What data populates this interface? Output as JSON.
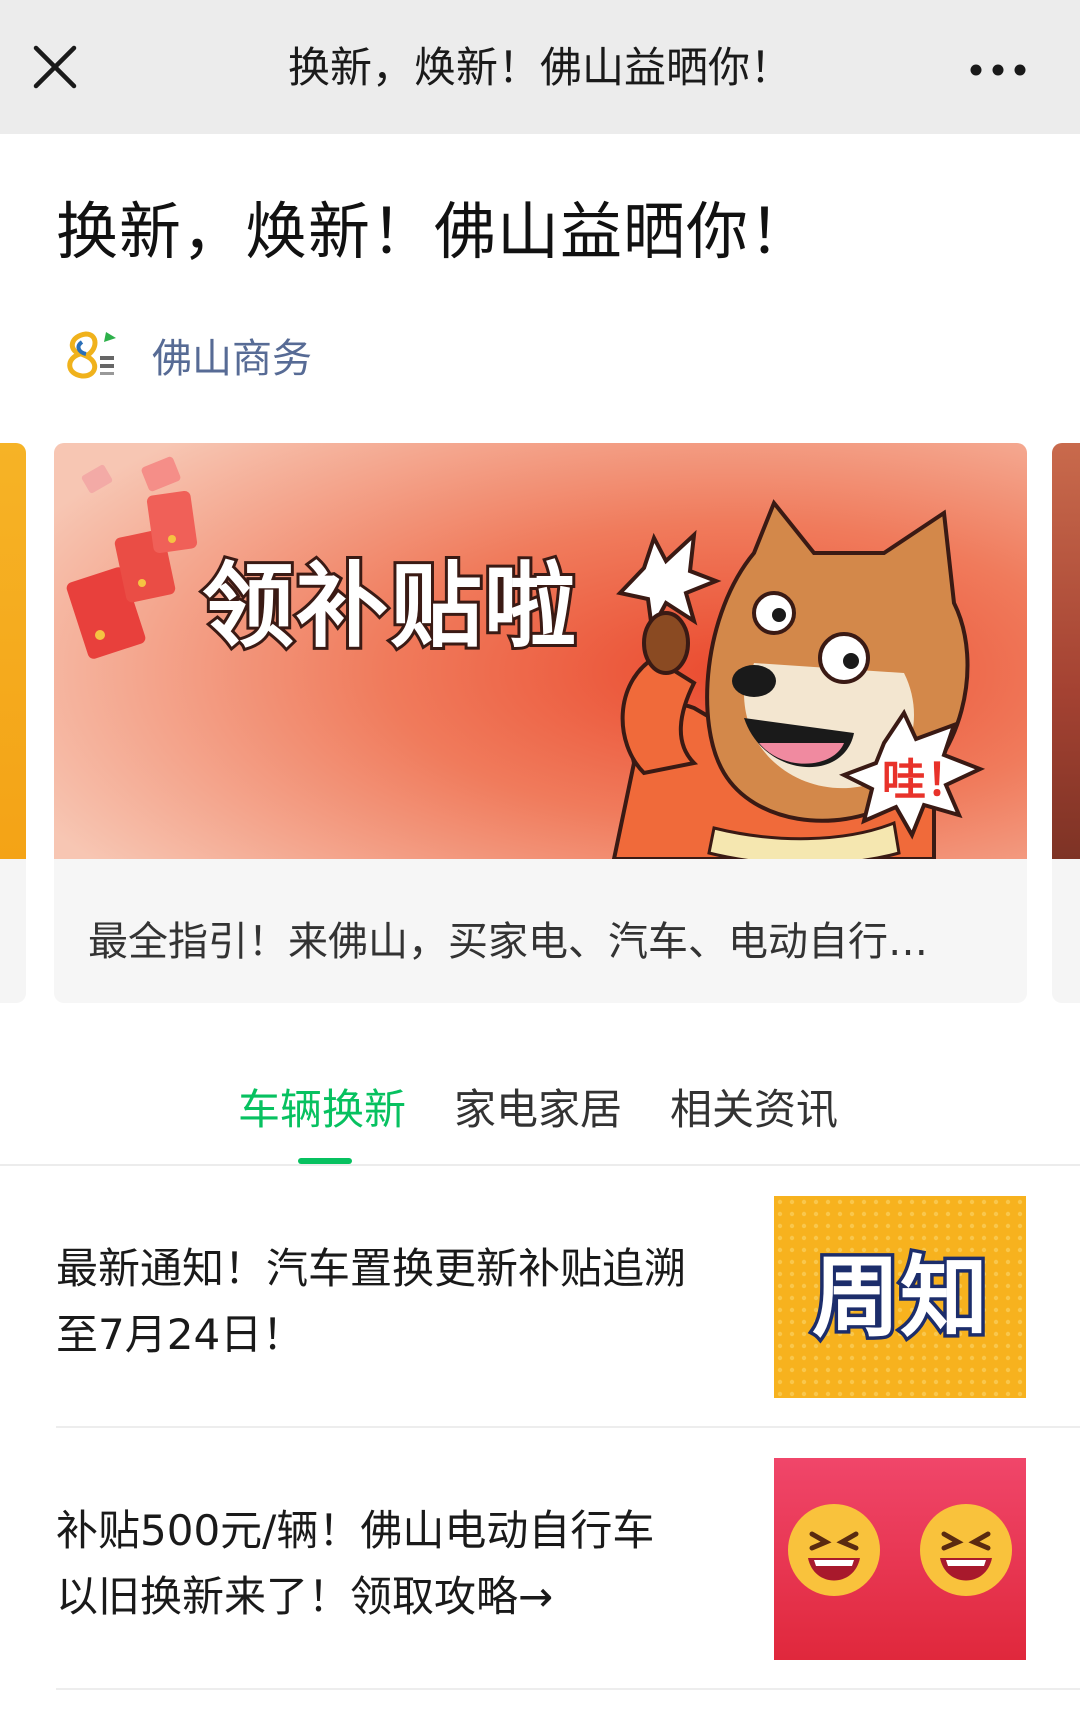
{
  "topbar": {
    "title": "换新，焕新！佛山益晒你！"
  },
  "article": {
    "title": "换新，焕新！佛山益晒你！",
    "account_name": "佛山商务"
  },
  "carousel": {
    "banner_headline": "领补贴啦",
    "banner_exclaim": "哇！",
    "caption": "最全指引！来佛山，买家电、汽车、电动自行…"
  },
  "tabs": [
    {
      "label": "车辆换新",
      "active": true
    },
    {
      "label": "家电家居",
      "active": false
    },
    {
      "label": "相关资讯",
      "active": false
    }
  ],
  "news": [
    {
      "line1": "最新通知！汽车置换更新补贴追溯",
      "line2": "至7月24日！",
      "thumb_text": "周知"
    },
    {
      "line1": "补贴500元/辆！佛山电动自行车",
      "line2": "以旧换新来了！领取攻略→"
    }
  ],
  "colors": {
    "accent_green": "#07c160",
    "account_link": "#576b95",
    "topbar_bg": "#ececec"
  }
}
